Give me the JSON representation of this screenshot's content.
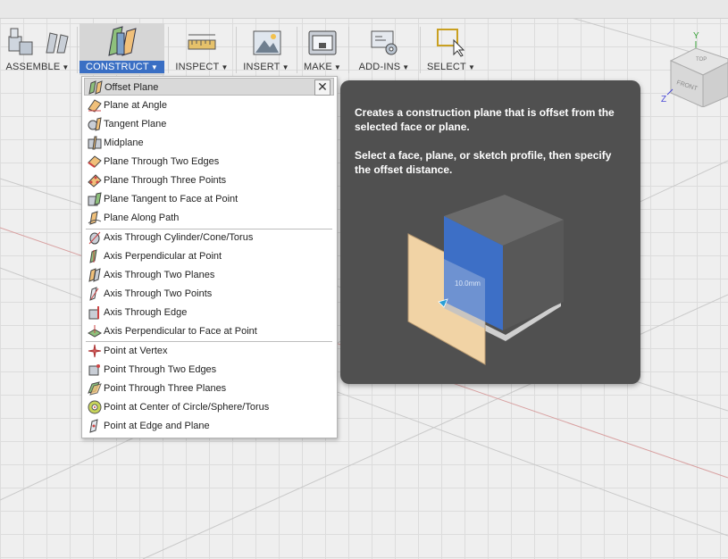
{
  "toolbar": {
    "groups": [
      {
        "label": "ASSEMBLE",
        "icon": "assemble-icon"
      },
      {
        "label": "CONSTRUCT",
        "icon": "construct-icon",
        "active": true
      },
      {
        "label": "INSPECT",
        "icon": "measure-ruler-icon"
      },
      {
        "label": "INSERT",
        "icon": "insert-image-icon"
      },
      {
        "label": "MAKE",
        "icon": "3d-printer-icon"
      },
      {
        "label": "ADD-INS",
        "icon": "add-ins-gear-icon"
      },
      {
        "label": "SELECT",
        "icon": "select-cursor-icon"
      }
    ],
    "caret": "▼"
  },
  "menu": {
    "close_glyph": "✕",
    "items": [
      {
        "label": "Offset Plane",
        "icon": "offset-plane-icon",
        "highlighted": true
      },
      {
        "label": "Plane at Angle",
        "icon": "plane-angle-icon"
      },
      {
        "label": "Tangent Plane",
        "icon": "tangent-plane-icon"
      },
      {
        "label": "Midplane",
        "icon": "midplane-icon"
      },
      {
        "label": "Plane Through Two Edges",
        "icon": "plane-two-edges-icon"
      },
      {
        "label": "Plane Through Three Points",
        "icon": "plane-three-points-icon"
      },
      {
        "label": "Plane Tangent to Face at Point",
        "icon": "plane-tangent-face-icon"
      },
      {
        "label": "Plane Along Path",
        "icon": "plane-along-path-icon"
      },
      {
        "label": "Axis Through Cylinder/Cone/Torus",
        "icon": "axis-cylinder-icon"
      },
      {
        "label": "Axis Perpendicular at Point",
        "icon": "axis-perpendicular-icon"
      },
      {
        "label": "Axis Through Two Planes",
        "icon": "axis-two-planes-icon"
      },
      {
        "label": "Axis Through Two Points",
        "icon": "axis-two-points-icon"
      },
      {
        "label": "Axis Through Edge",
        "icon": "axis-edge-icon"
      },
      {
        "label": "Axis Perpendicular to Face at Point",
        "icon": "axis-perp-face-icon"
      },
      {
        "label": "Point at Vertex",
        "icon": "point-vertex-icon"
      },
      {
        "label": "Point Through Two Edges",
        "icon": "point-two-edges-icon"
      },
      {
        "label": "Point Through Three Planes",
        "icon": "point-three-planes-icon"
      },
      {
        "label": "Point at Center of Circle/Sphere/Torus",
        "icon": "point-center-icon"
      },
      {
        "label": "Point at Edge and Plane",
        "icon": "point-edge-plane-icon"
      }
    ]
  },
  "tooltip": {
    "line1": "Creates a construction plane that is offset from the selected face or plane.",
    "line2": "Select a face, plane, or sketch profile, then specify the offset distance.",
    "dimension": "10.0mm"
  },
  "viewcube": {
    "top": "TOP",
    "front": "FRONT",
    "axis_y": "Y",
    "axis_z": "Z"
  },
  "colors": {
    "accent": "#3a6fc4",
    "tooltip_bg": "#505050",
    "plane_fill": "#f1d3a5",
    "face_blue": "#3d6fc6"
  }
}
